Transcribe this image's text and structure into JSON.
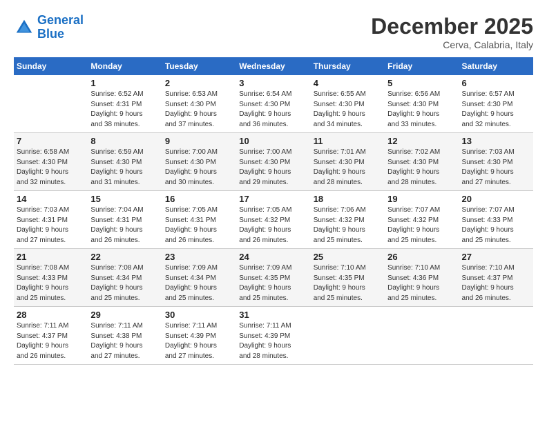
{
  "header": {
    "logo_line1": "General",
    "logo_line2": "Blue",
    "month": "December 2025",
    "location": "Cerva, Calabria, Italy"
  },
  "weekdays": [
    "Sunday",
    "Monday",
    "Tuesday",
    "Wednesday",
    "Thursday",
    "Friday",
    "Saturday"
  ],
  "weeks": [
    [
      {
        "day": "",
        "info": ""
      },
      {
        "day": "1",
        "info": "Sunrise: 6:52 AM\nSunset: 4:31 PM\nDaylight: 9 hours\nand 38 minutes."
      },
      {
        "day": "2",
        "info": "Sunrise: 6:53 AM\nSunset: 4:30 PM\nDaylight: 9 hours\nand 37 minutes."
      },
      {
        "day": "3",
        "info": "Sunrise: 6:54 AM\nSunset: 4:30 PM\nDaylight: 9 hours\nand 36 minutes."
      },
      {
        "day": "4",
        "info": "Sunrise: 6:55 AM\nSunset: 4:30 PM\nDaylight: 9 hours\nand 34 minutes."
      },
      {
        "day": "5",
        "info": "Sunrise: 6:56 AM\nSunset: 4:30 PM\nDaylight: 9 hours\nand 33 minutes."
      },
      {
        "day": "6",
        "info": "Sunrise: 6:57 AM\nSunset: 4:30 PM\nDaylight: 9 hours\nand 32 minutes."
      }
    ],
    [
      {
        "day": "7",
        "info": "Sunrise: 6:58 AM\nSunset: 4:30 PM\nDaylight: 9 hours\nand 32 minutes."
      },
      {
        "day": "8",
        "info": "Sunrise: 6:59 AM\nSunset: 4:30 PM\nDaylight: 9 hours\nand 31 minutes."
      },
      {
        "day": "9",
        "info": "Sunrise: 7:00 AM\nSunset: 4:30 PM\nDaylight: 9 hours\nand 30 minutes."
      },
      {
        "day": "10",
        "info": "Sunrise: 7:00 AM\nSunset: 4:30 PM\nDaylight: 9 hours\nand 29 minutes."
      },
      {
        "day": "11",
        "info": "Sunrise: 7:01 AM\nSunset: 4:30 PM\nDaylight: 9 hours\nand 28 minutes."
      },
      {
        "day": "12",
        "info": "Sunrise: 7:02 AM\nSunset: 4:30 PM\nDaylight: 9 hours\nand 28 minutes."
      },
      {
        "day": "13",
        "info": "Sunrise: 7:03 AM\nSunset: 4:30 PM\nDaylight: 9 hours\nand 27 minutes."
      }
    ],
    [
      {
        "day": "14",
        "info": "Sunrise: 7:03 AM\nSunset: 4:31 PM\nDaylight: 9 hours\nand 27 minutes."
      },
      {
        "day": "15",
        "info": "Sunrise: 7:04 AM\nSunset: 4:31 PM\nDaylight: 9 hours\nand 26 minutes."
      },
      {
        "day": "16",
        "info": "Sunrise: 7:05 AM\nSunset: 4:31 PM\nDaylight: 9 hours\nand 26 minutes."
      },
      {
        "day": "17",
        "info": "Sunrise: 7:05 AM\nSunset: 4:32 PM\nDaylight: 9 hours\nand 26 minutes."
      },
      {
        "day": "18",
        "info": "Sunrise: 7:06 AM\nSunset: 4:32 PM\nDaylight: 9 hours\nand 25 minutes."
      },
      {
        "day": "19",
        "info": "Sunrise: 7:07 AM\nSunset: 4:32 PM\nDaylight: 9 hours\nand 25 minutes."
      },
      {
        "day": "20",
        "info": "Sunrise: 7:07 AM\nSunset: 4:33 PM\nDaylight: 9 hours\nand 25 minutes."
      }
    ],
    [
      {
        "day": "21",
        "info": "Sunrise: 7:08 AM\nSunset: 4:33 PM\nDaylight: 9 hours\nand 25 minutes."
      },
      {
        "day": "22",
        "info": "Sunrise: 7:08 AM\nSunset: 4:34 PM\nDaylight: 9 hours\nand 25 minutes."
      },
      {
        "day": "23",
        "info": "Sunrise: 7:09 AM\nSunset: 4:34 PM\nDaylight: 9 hours\nand 25 minutes."
      },
      {
        "day": "24",
        "info": "Sunrise: 7:09 AM\nSunset: 4:35 PM\nDaylight: 9 hours\nand 25 minutes."
      },
      {
        "day": "25",
        "info": "Sunrise: 7:10 AM\nSunset: 4:35 PM\nDaylight: 9 hours\nand 25 minutes."
      },
      {
        "day": "26",
        "info": "Sunrise: 7:10 AM\nSunset: 4:36 PM\nDaylight: 9 hours\nand 25 minutes."
      },
      {
        "day": "27",
        "info": "Sunrise: 7:10 AM\nSunset: 4:37 PM\nDaylight: 9 hours\nand 26 minutes."
      }
    ],
    [
      {
        "day": "28",
        "info": "Sunrise: 7:11 AM\nSunset: 4:37 PM\nDaylight: 9 hours\nand 26 minutes."
      },
      {
        "day": "29",
        "info": "Sunrise: 7:11 AM\nSunset: 4:38 PM\nDaylight: 9 hours\nand 27 minutes."
      },
      {
        "day": "30",
        "info": "Sunrise: 7:11 AM\nSunset: 4:39 PM\nDaylight: 9 hours\nand 27 minutes."
      },
      {
        "day": "31",
        "info": "Sunrise: 7:11 AM\nSunset: 4:39 PM\nDaylight: 9 hours\nand 28 minutes."
      },
      {
        "day": "",
        "info": ""
      },
      {
        "day": "",
        "info": ""
      },
      {
        "day": "",
        "info": ""
      }
    ]
  ]
}
